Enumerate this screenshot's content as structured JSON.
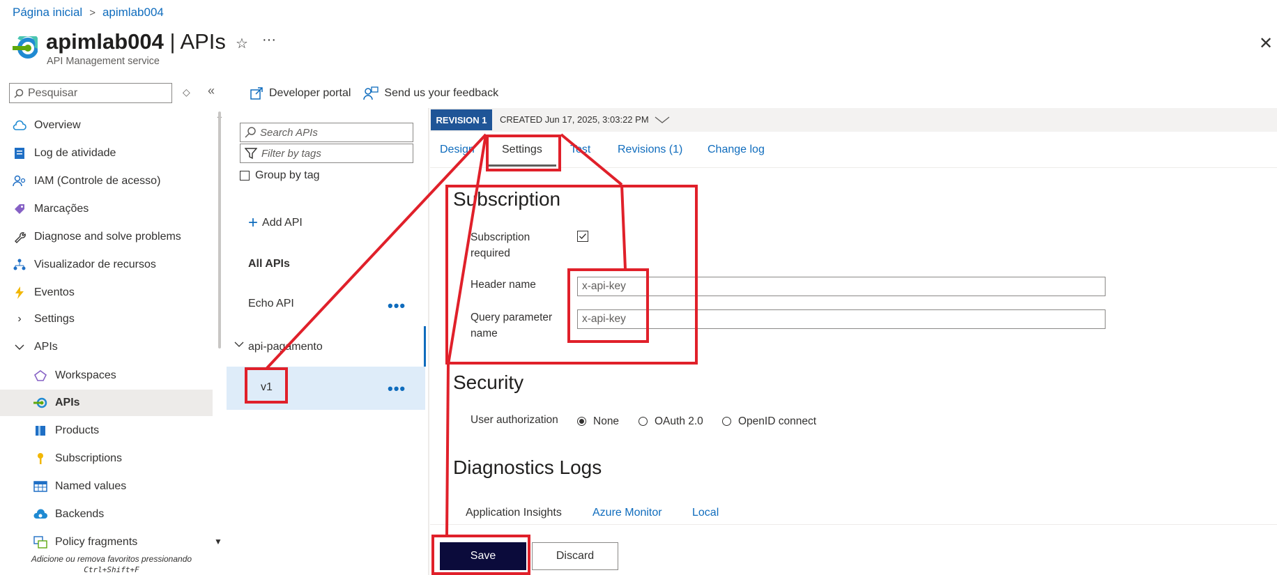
{
  "breadcrumb": {
    "home": "Página inicial",
    "current": "apimlab004"
  },
  "header": {
    "title": "apimlab004",
    "section": "| APIs",
    "subtitle": "API Management service"
  },
  "sidebar": {
    "search_placeholder": "Pesquisar",
    "items": [
      {
        "label": "Overview",
        "icon": "cloud-icon"
      },
      {
        "label": "Log de atividade",
        "icon": "activity-log-icon"
      },
      {
        "label": "IAM (Controle de acesso)",
        "icon": "iam-icon"
      },
      {
        "label": "Marcações",
        "icon": "tag-icon"
      },
      {
        "label": "Diagnose and solve problems",
        "icon": "wrench-icon"
      },
      {
        "label": "Visualizador de recursos",
        "icon": "resource-visualizer-icon"
      },
      {
        "label": "Eventos",
        "icon": "lightning-icon"
      },
      {
        "label": "Settings",
        "icon": "chevron-right-icon"
      },
      {
        "label": "APIs",
        "icon": "chevron-down-icon"
      },
      {
        "label": "Workspaces",
        "icon": "workspaces-icon"
      },
      {
        "label": "APIs",
        "icon": "api-icon"
      },
      {
        "label": "Products",
        "icon": "products-icon"
      },
      {
        "label": "Subscriptions",
        "icon": "key-icon"
      },
      {
        "label": "Named values",
        "icon": "table-icon"
      },
      {
        "label": "Backends",
        "icon": "backends-icon"
      },
      {
        "label": "Policy fragments",
        "icon": "policy-icon"
      }
    ],
    "tip": "Adicione ou remova favoritos pressionando",
    "tip_shortcut": "Ctrl+Shift+F"
  },
  "toolbar": {
    "developer_portal": "Developer portal",
    "feedback": "Send us your feedback"
  },
  "apis_panel": {
    "search_placeholder": "Search APIs",
    "filter_placeholder": "Filter by tags",
    "group_by_tag": "Group by tag",
    "add_api": "Add API",
    "all_apis": "All APIs",
    "apis": [
      {
        "name": "Echo API"
      },
      {
        "name": "api-pagamento"
      }
    ],
    "selected_version": "v1",
    "more": "•••"
  },
  "revision": {
    "tag": "REVISION 1",
    "created": "CREATED Jun 17, 2025, 3:03:22 PM"
  },
  "tabs": [
    "Design",
    "Settings",
    "Test",
    "Revisions (1)",
    "Change log"
  ],
  "subscription": {
    "heading": "Subscription",
    "required_label": "Subscription required",
    "required": true,
    "header_name_label": "Header name",
    "header_name_value": "x-api-key",
    "query_param_label": "Query parameter name",
    "query_param_value": "x-api-key"
  },
  "security": {
    "heading": "Security",
    "user_auth_label": "User authorization",
    "options": [
      "None",
      "OAuth 2.0",
      "OpenID connect"
    ],
    "selected": "None"
  },
  "diagnostics": {
    "heading": "Diagnostics Logs",
    "tabs": [
      "Application Insights",
      "Azure Monitor",
      "Local"
    ]
  },
  "actions": {
    "save": "Save",
    "discard": "Discard"
  },
  "colors": {
    "accent": "#0f6cbd",
    "annotation": "#e0202a",
    "save_bg": "#0b0b3b",
    "revision_bg": "#1f5597"
  }
}
